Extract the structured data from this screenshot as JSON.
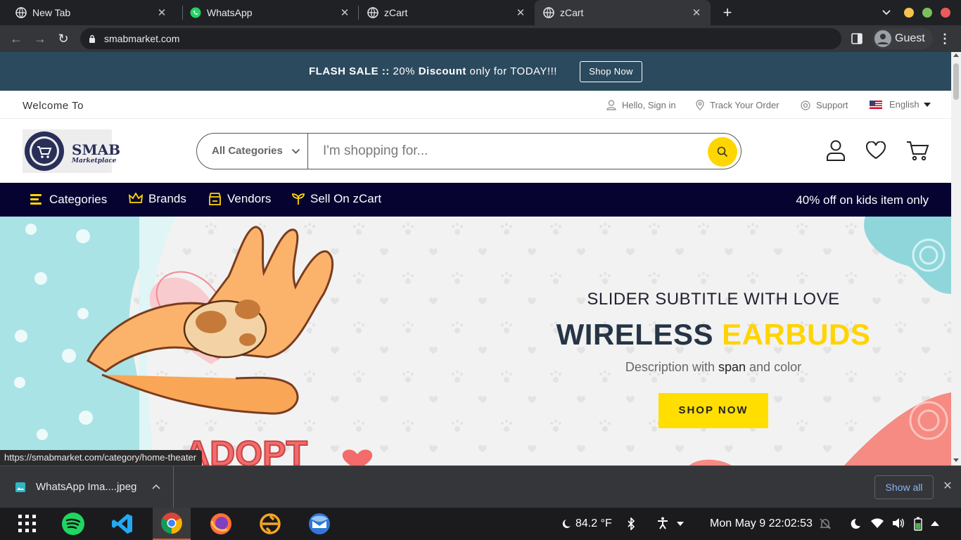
{
  "browser": {
    "tabs": [
      {
        "title": "New Tab",
        "icon": "globe-icon",
        "active": false
      },
      {
        "title": "WhatsApp",
        "icon": "whatsapp-icon",
        "active": false
      },
      {
        "title": "zCart",
        "icon": "globe-icon",
        "active": false
      },
      {
        "title": "zCart",
        "icon": "globe-icon",
        "active": true
      }
    ],
    "url": "smabmarket.com",
    "profile": "Guest",
    "status_link": "https://smabmarket.com/category/home-theater"
  },
  "flash_sale": {
    "label": "FLASH SALE ::",
    "percent": "20%",
    "discount": "Discount",
    "rest": "only for TODAY!!!",
    "button": "Shop Now"
  },
  "topbar": {
    "welcome": "Welcome To",
    "sign_in": "Hello, Sign in",
    "track": "Track Your Order",
    "support": "Support",
    "language": "English"
  },
  "header": {
    "logo_text": "SMAB",
    "logo_sub": "Marketplace",
    "category_select": "All Categories",
    "search_placeholder": "I'm shopping for..."
  },
  "nav": {
    "items": [
      "Categories",
      "Brands",
      "Vendors",
      "Sell On zCart"
    ],
    "promo": "40% off on kids item only"
  },
  "hero": {
    "subtitle": "SLIDER SUBTITLE WITH LOVE",
    "title_a": "WIRELESS",
    "title_b": "EARBUDS",
    "desc_a": "Description with",
    "desc_b": "span",
    "desc_c": "and color",
    "button": "SHOP NOW",
    "adopt_text": "ADOPT"
  },
  "downloads": {
    "file": "WhatsApp Ima....jpeg",
    "show_all": "Show all"
  },
  "taskbar": {
    "weather": "84.2 °F",
    "datetime": "Mon May 9  22:02:53"
  },
  "colors": {
    "flash_bg": "#2c4a5e",
    "nav_bg": "#060331",
    "accent": "#ffd600"
  }
}
